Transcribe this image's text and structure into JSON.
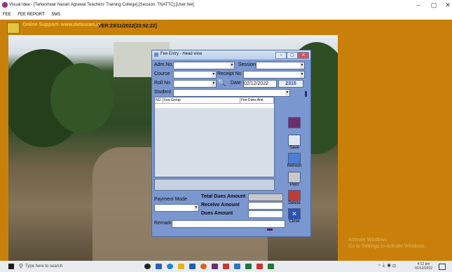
{
  "window": {
    "title": "Visual Idea - [Tarkeshwar Narain Agrawal Teachers' Training College],[Session: TNATTC],[User fee]",
    "controls": [
      "–",
      "▢",
      "✕"
    ]
  },
  "menu": {
    "items": [
      "FEE",
      "FEE REPORT",
      "SMS"
    ]
  },
  "infobar": {
    "support": "Online Support- www.datascan.in",
    "version": "VER:23/11/2022[23:52:22]"
  },
  "dialog": {
    "title": "Fee Entry - Head wise",
    "labels": {
      "adm_no": "Adm.No.",
      "session": "Session",
      "course": "Course",
      "receipt_no": "Receipt No",
      "roll_no": "Roll No",
      "date": "Date",
      "student": "Student",
      "payment_mode": "Payment Mode",
      "total_dues": "Total Dues Amount",
      "receive_amount": "Receive Amount",
      "dues_amount": "Dues Amount",
      "remark": "Remark"
    },
    "values": {
      "date": "02/12/2022",
      "number": "2315"
    },
    "grid": {
      "columns": [
        "NO.",
        "Fee Group",
        "Fee Dues Amt"
      ]
    },
    "buttons": {
      "save": "Save",
      "refresh": "Refresh",
      "print": "Print",
      "delete": "Delete",
      "close": "Close"
    }
  },
  "watermark": {
    "line1": "Activate Windows",
    "line2": "Go to Settings to activate Windows."
  },
  "taskbar": {
    "search_placeholder": "Type here to search",
    "time": "4:12 pm",
    "date": "02/12/2022"
  }
}
